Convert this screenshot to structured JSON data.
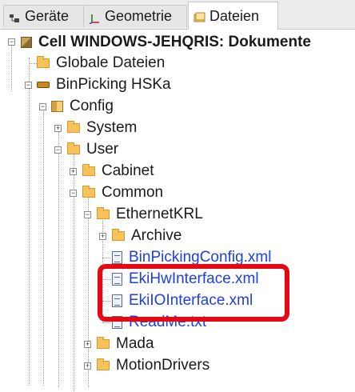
{
  "tabs": [
    {
      "label": "Geräte",
      "icon": "device-icon",
      "active": false
    },
    {
      "label": "Geometrie",
      "icon": "axes-icon",
      "active": false
    },
    {
      "label": "Dateien",
      "icon": "files-icon",
      "active": true
    }
  ],
  "tree": {
    "root": "Cell WINDOWS-JEHQRIS: Dokumente",
    "global_files": "Globale Dateien",
    "robot": "BinPicking HSKa",
    "config": "Config",
    "system": "System",
    "user": "User",
    "cabinet": "Cabinet",
    "common": "Common",
    "ethernetkrl": "EthernetKRL",
    "archive": "Archive",
    "file_binpicking": "BinPickingConfig.xml",
    "file_ekihw": "EkiHwInterface.xml",
    "file_ekiio": "EkiIOInterface.xml",
    "file_readme": "ReadMe.txt",
    "mada": "Mada",
    "motiondrivers": "MotionDrivers"
  },
  "highlight": {
    "color": "#e50914"
  },
  "colors": {
    "link": "#1f3fd9",
    "folder": "#f7c25a"
  }
}
